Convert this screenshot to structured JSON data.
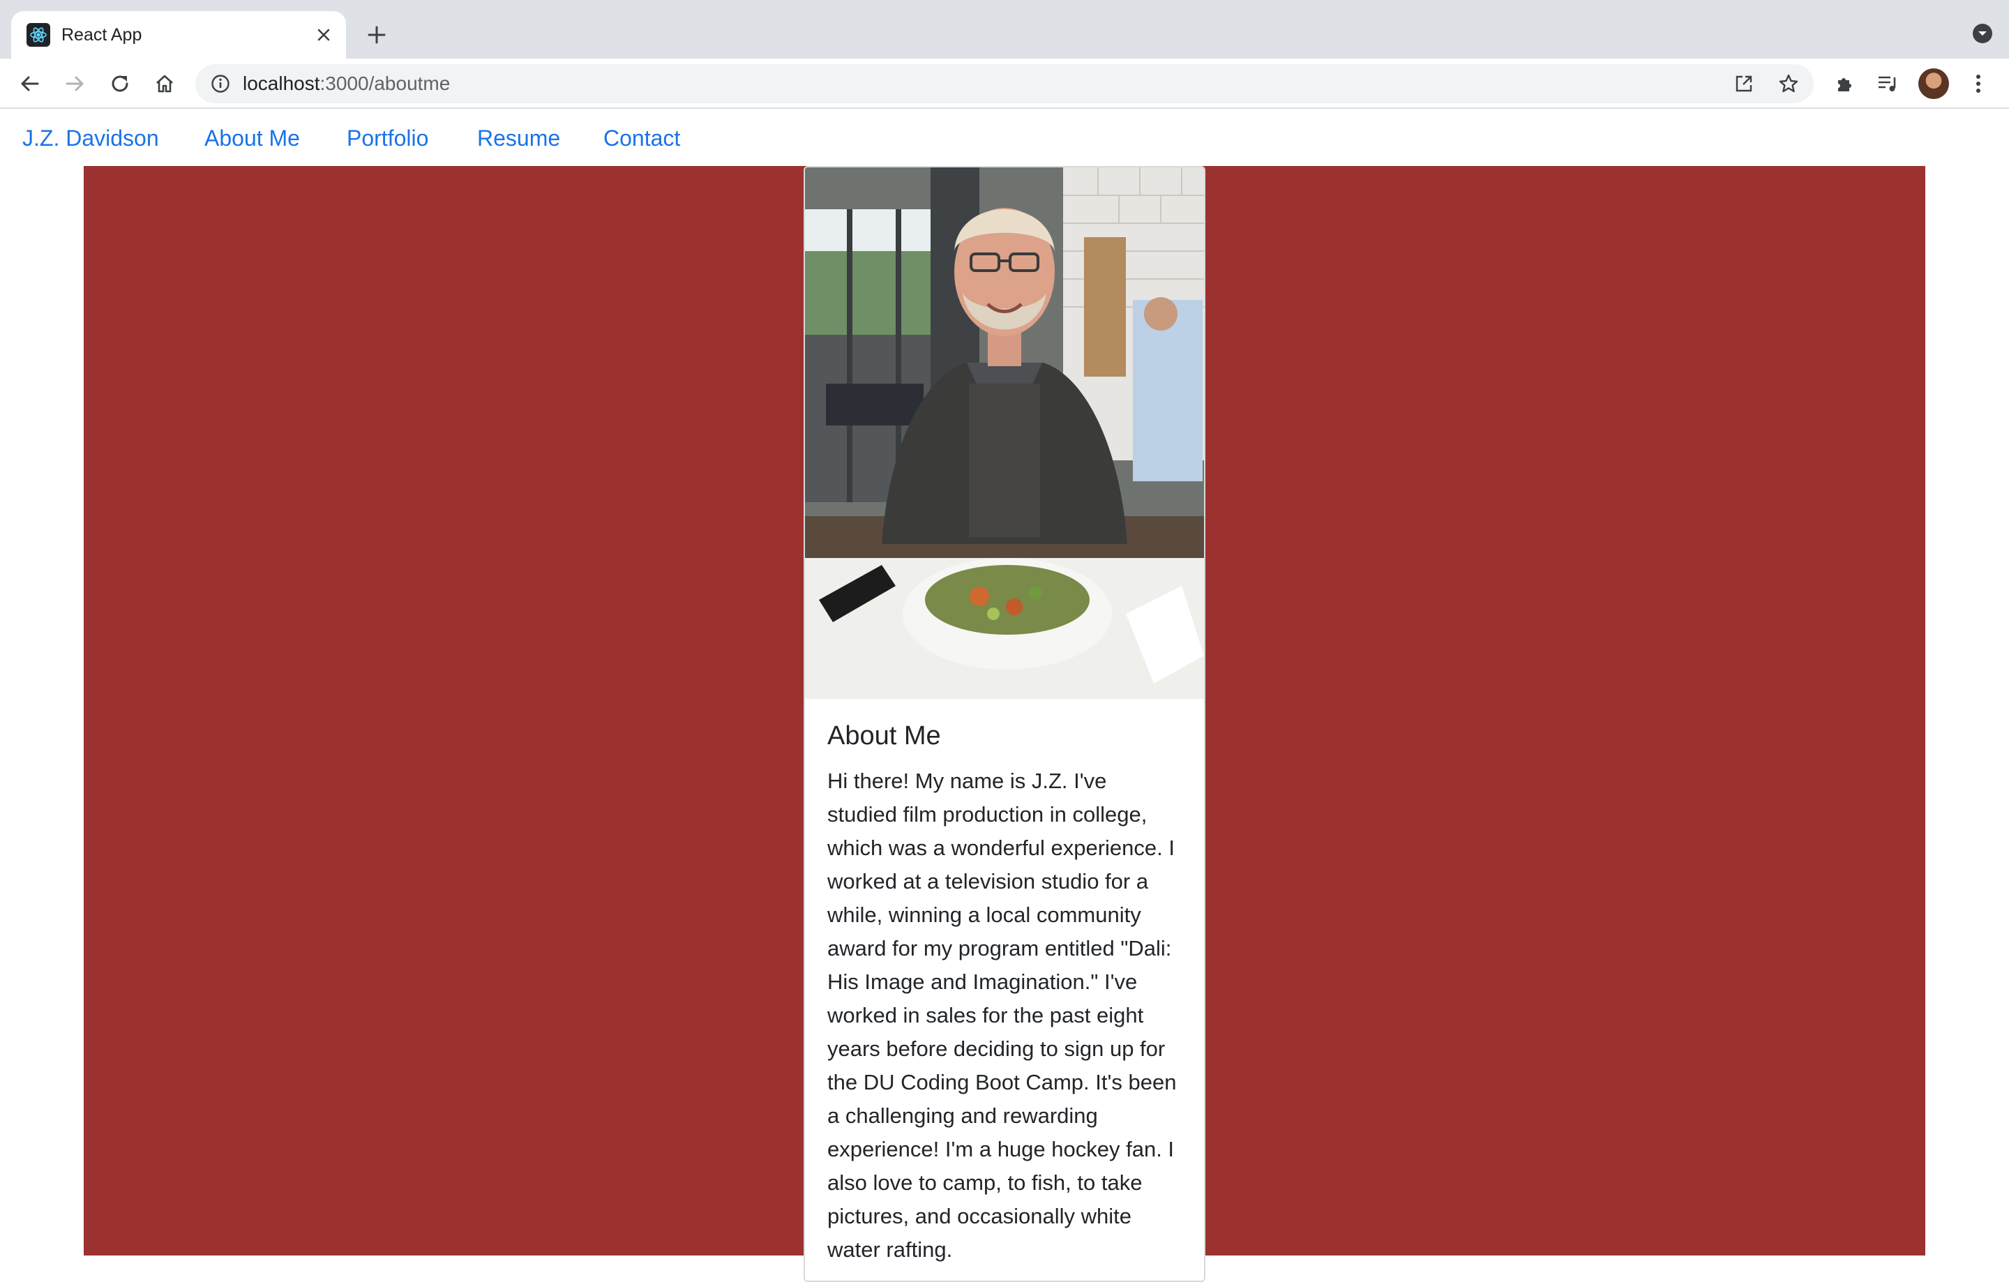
{
  "browser": {
    "tab": {
      "title": "React App",
      "favicon": "react-logo-icon"
    },
    "toolbar": {
      "url_host": "localhost",
      "url_path": ":3000/aboutme",
      "icons": [
        "back-icon",
        "forward-icon",
        "reload-icon",
        "home-icon",
        "info-icon",
        "open-in-app-icon",
        "star-icon",
        "extensions-icon",
        "reading-list-icon",
        "profile-avatar",
        "menu-icon"
      ]
    }
  },
  "navbar": {
    "brand": "J.Z. Davidson",
    "links": [
      "About Me",
      "Portfolio",
      "Resume",
      "Contact"
    ]
  },
  "card": {
    "title": "About Me",
    "text": "Hi there! My name is J.Z. I've studied film production in college, which was a wonderful experience. I worked at a television studio for a while, winning a local community award for my program entitled \"Dali: His Image and Imagination.\" I've worked in sales for the past eight years before deciding to sign up for the DU Coding Boot Camp. It's been a challenging and rewarding experience! I'm a huge hockey fan. I also love to camp, to fish, to take pictures, and occasionally white water rafting."
  },
  "colors": {
    "hero_background": "#9b3230",
    "link": "#1a73e8",
    "text": "#212529"
  }
}
